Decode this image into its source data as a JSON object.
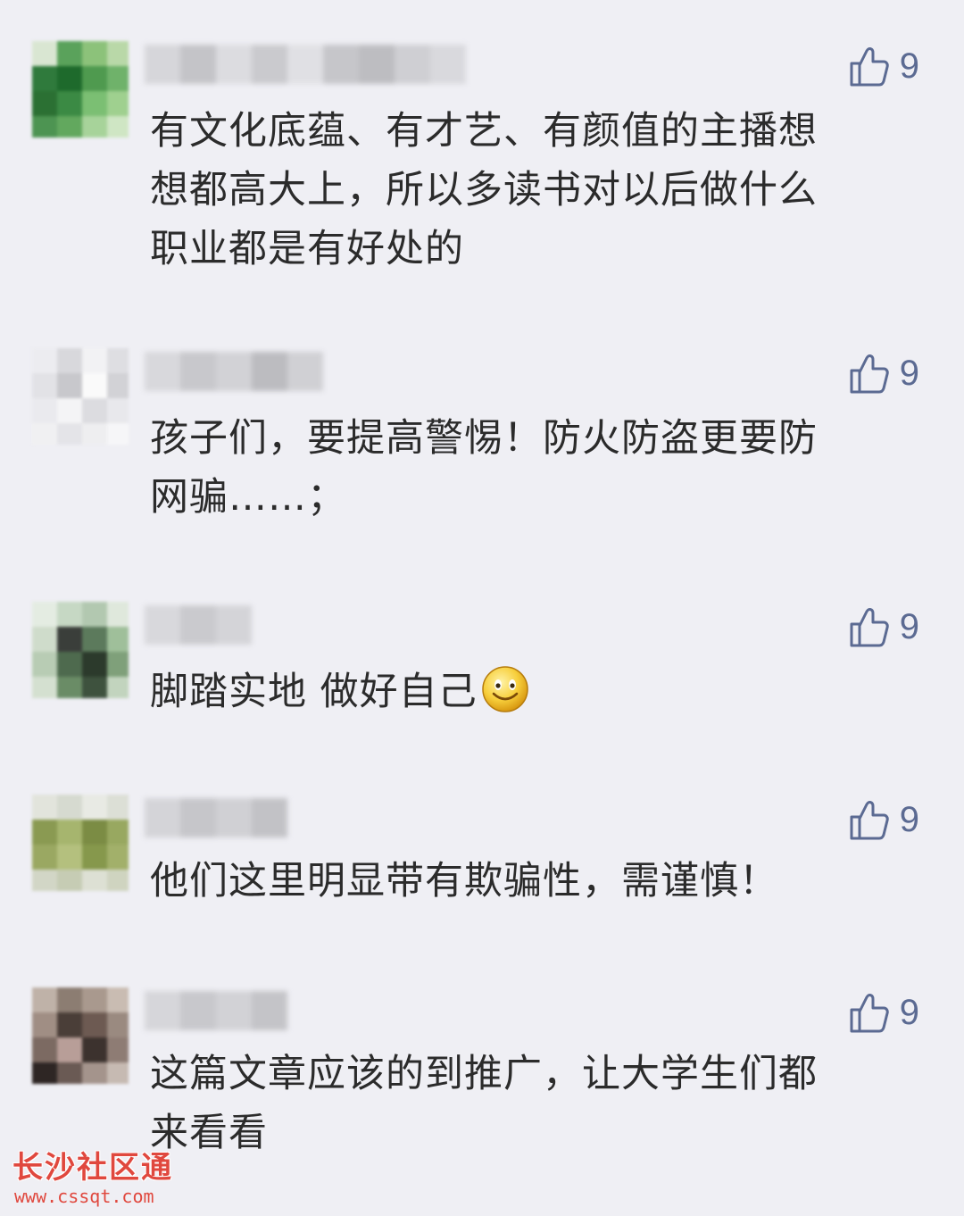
{
  "comments": [
    {
      "likes": "9",
      "text_lines": [
        "有文化底蕴、有才艺、有颜值的主播想",
        "想都高大上，所以多读书对以后做什么",
        "职业都是有好处的"
      ]
    },
    {
      "likes": "9",
      "text_lines": [
        "孩子们，要提高警惕！防火防盗更要防",
        "网骗……；"
      ]
    },
    {
      "likes": "9",
      "text_lines": [
        "脚踏实地 做好自己"
      ],
      "emoji": "smile-emoji"
    },
    {
      "likes": "9",
      "text_lines": [
        "他们这里明显带有欺骗性，需谨慎！"
      ]
    },
    {
      "likes": "9",
      "text_lines": [
        "这篇文章应该的到推广，让大学生们都",
        "来看看"
      ]
    }
  ],
  "watermark": {
    "title": "长沙社区通",
    "url": "www.cssqt.com"
  },
  "colors": {
    "background": "#efeff4",
    "like_icon": "#5b6a92",
    "watermark": "#e0483e"
  },
  "icons": {
    "like": "thumbs-up-icon"
  }
}
